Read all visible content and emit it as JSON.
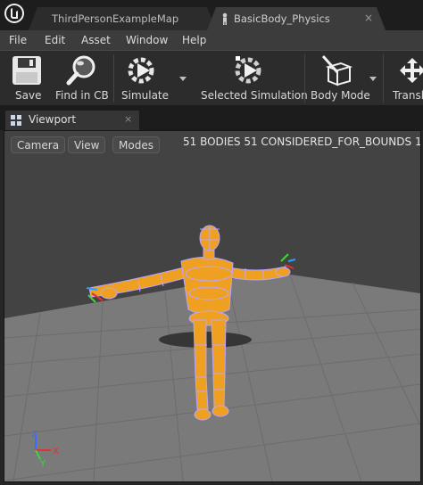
{
  "tabs": [
    {
      "label": "ThirdPersonExampleMap"
    },
    {
      "label": "BasicBody_Physics",
      "close_icon": "×"
    }
  ],
  "menu": [
    "File",
    "Edit",
    "Asset",
    "Window",
    "Help"
  ],
  "toolbar": {
    "save": "Save",
    "find_in_cb": "Find in CB",
    "simulate": "Simulate",
    "selected_simulation": "Selected Simulation",
    "body_mode": "Body Mode",
    "translate": "Transl"
  },
  "viewport_tab": {
    "title": "Viewport",
    "close_icon": "×"
  },
  "viewport": {
    "buttons": [
      "Camera",
      "View",
      "Modes"
    ],
    "stats": "51 BODIES  51 CONSIDERED_FOR_BOUNDS  1",
    "axis_labels": {
      "z": "Z",
      "x": "X",
      "y": "Y"
    }
  },
  "colors": {
    "body": "#f0a020",
    "physics_outline": "#b9a6ff",
    "floor": "#7a7a7a",
    "sky": "#434343"
  }
}
